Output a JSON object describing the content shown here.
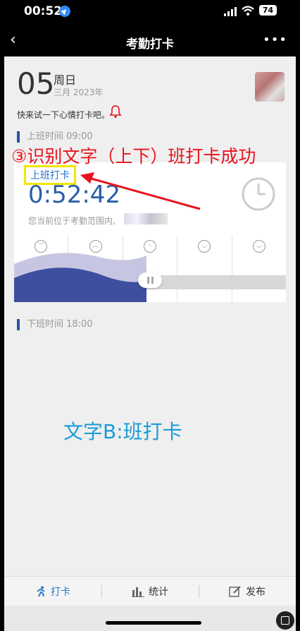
{
  "status_bar": {
    "time": "00:52",
    "battery": "74"
  },
  "nav": {
    "title": "考勤打卡",
    "back": "‹",
    "more": "•••"
  },
  "date": {
    "day": "05",
    "weekday": "周日",
    "month_year": "三月 2023年"
  },
  "tip": "快来试一下心情打卡吧。",
  "checkin": {
    "section_label": "上班时间 09:00",
    "punch_label": "上班打卡",
    "time": "0:52:42",
    "range_text": "您当前位于考勤范围内,"
  },
  "checkout": {
    "section_label": "下班时间 18:00"
  },
  "annotation": "③识别文字（上下）班打卡成功",
  "text_b": "文字B:班打卡",
  "tabs": [
    {
      "label": "打卡",
      "icon": "running-icon"
    },
    {
      "label": "统计",
      "icon": "bar-chart-icon"
    },
    {
      "label": "发布",
      "icon": "edit-icon"
    }
  ],
  "colors": {
    "accent": "#2a6fcf",
    "annotation": "#e8141d",
    "highlight": "#f3e600",
    "text_b": "#1a9bd7"
  }
}
